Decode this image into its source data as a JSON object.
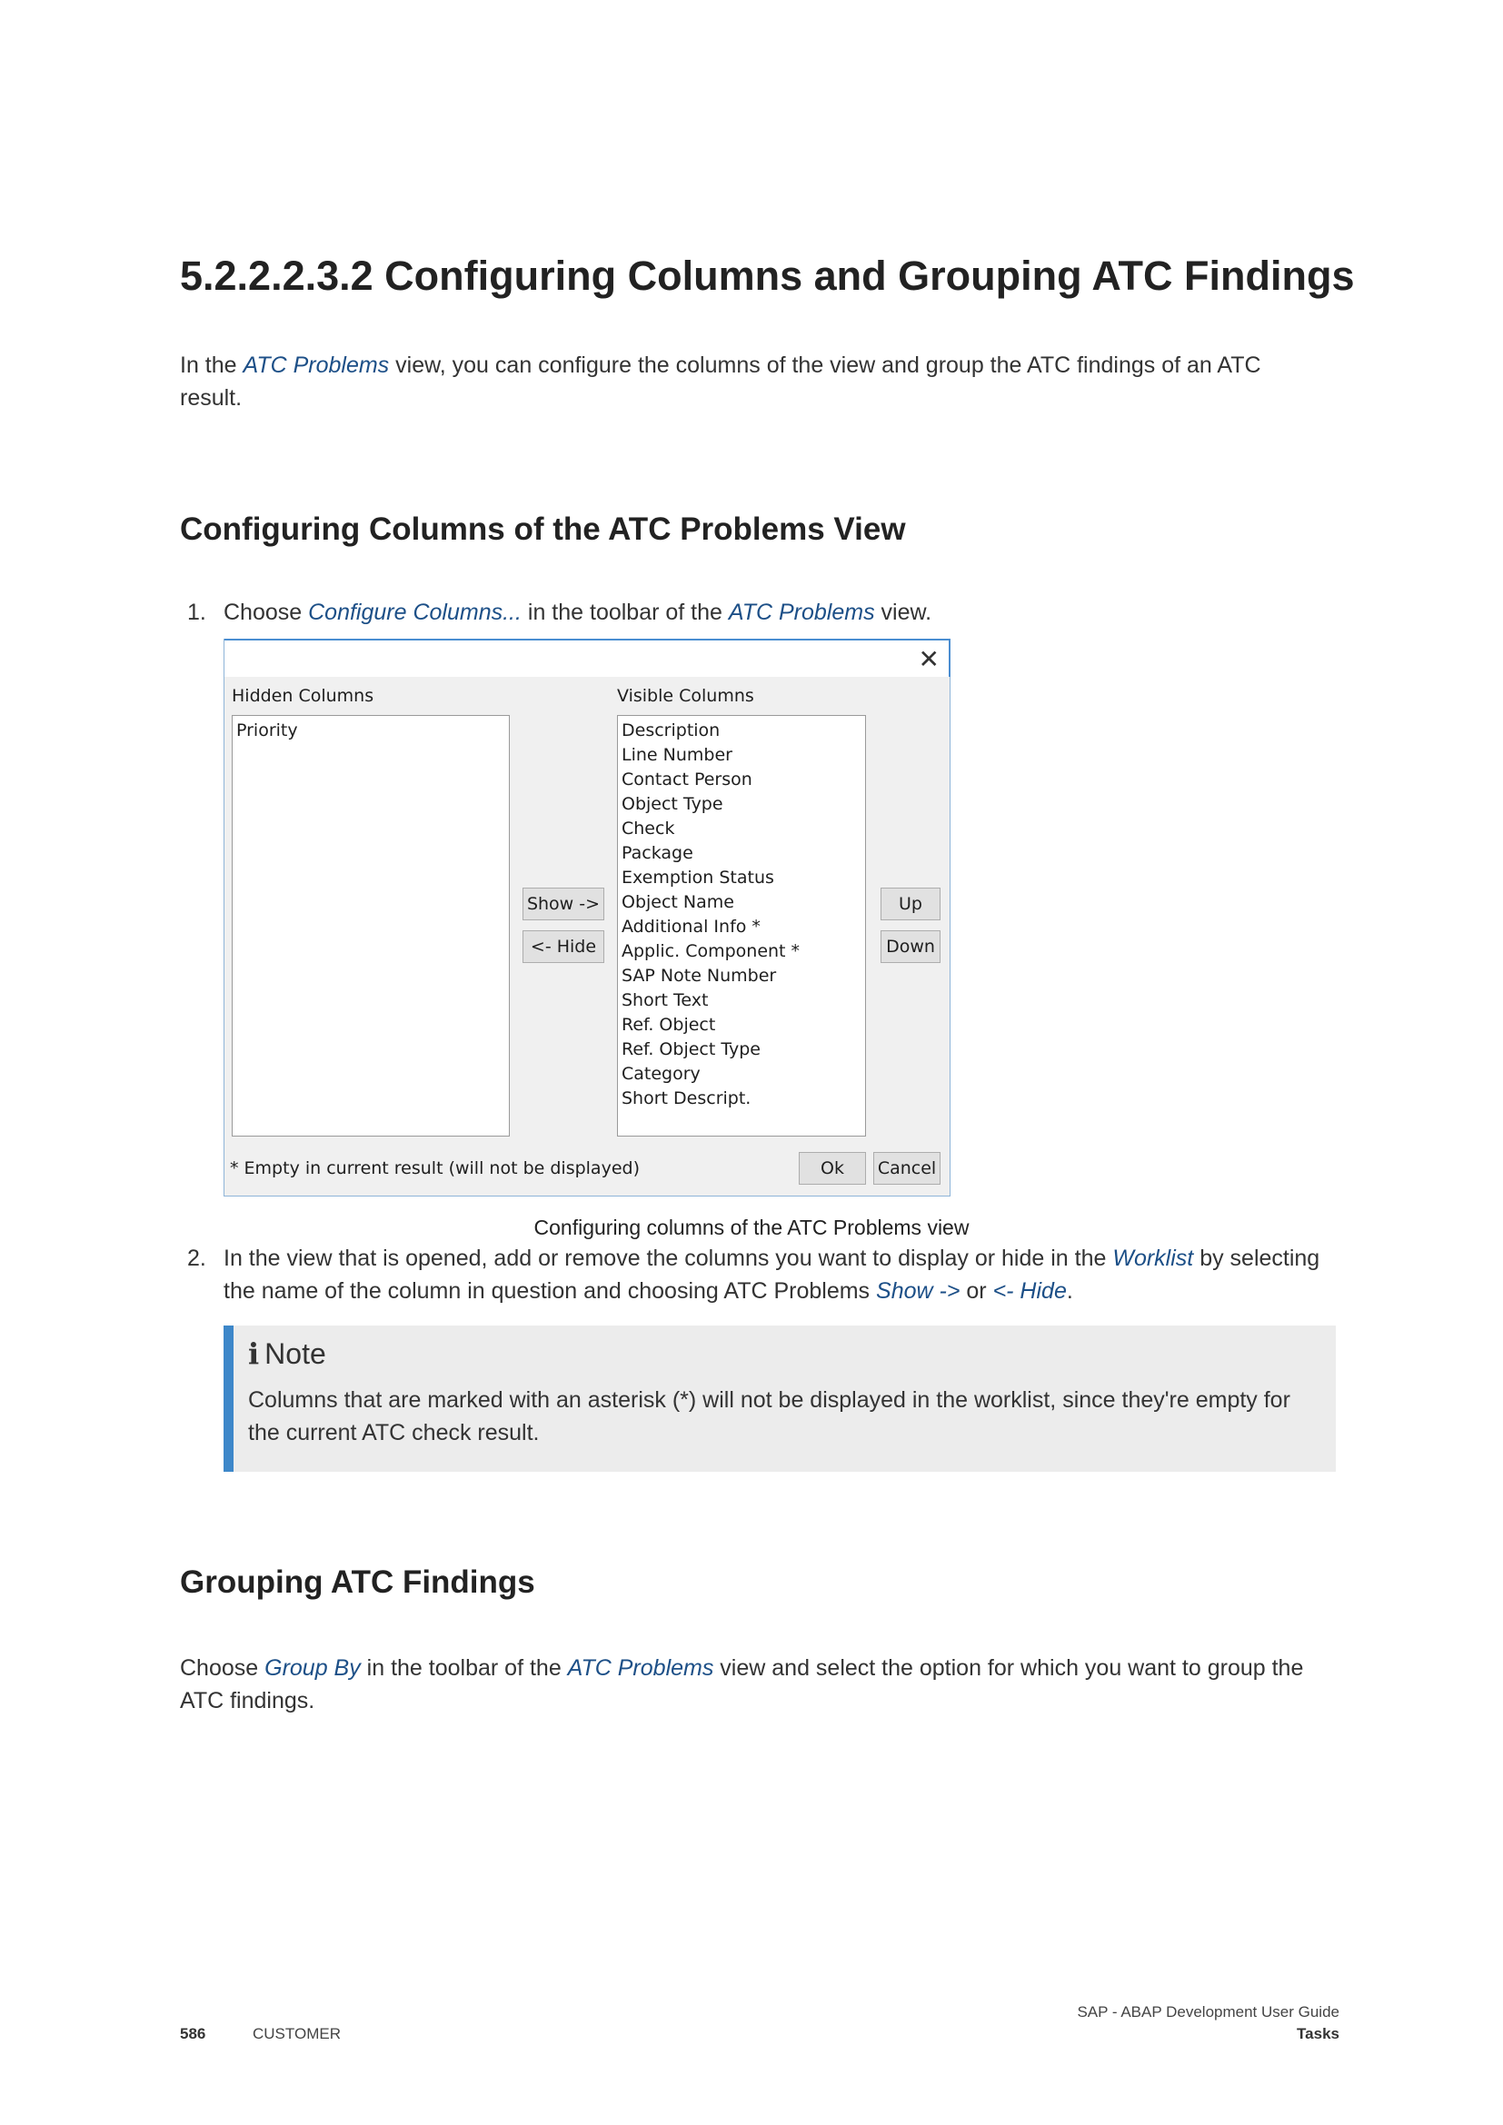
{
  "section_title": "5.2.2.2.3.2  Configuring Columns and Grouping ATC Findings",
  "intro": {
    "pre": "In the ",
    "link": "ATC Problems",
    "post": " view, you can configure the columns of the view and group the ATC findings of an ATC result."
  },
  "subsection1_title": "Configuring Columns of the ATC Problems View",
  "step1": {
    "num": "1.",
    "pre": "Choose ",
    "link1": "Configure Columns...",
    "mid": " in the toolbar of the ",
    "link2": "ATC Problems",
    "post": " view."
  },
  "dialog": {
    "close_glyph": "✕",
    "hidden_label": "Hidden Columns",
    "visible_label": "Visible Columns",
    "hidden_items": [
      "Priority"
    ],
    "visible_items": [
      "Description",
      "Line Number",
      "Contact Person",
      "Object Type",
      "Check",
      "Package",
      "Exemption Status",
      "Object Name",
      "Additional Info *",
      "Applic. Component *",
      "SAP Note Number",
      "Short Text",
      "Ref. Object",
      "Ref. Object Type",
      "Category",
      "Short Descript."
    ],
    "show_button": "Show ->",
    "hide_button": "<- Hide",
    "up_button": "Up",
    "down_button": "Down",
    "footnote": "* Empty in current result (will not be displayed)",
    "ok_button": "Ok",
    "cancel_button": "Cancel"
  },
  "figure_caption": "Configuring columns of the ATC Problems view",
  "step2": {
    "num": "2.",
    "pre": "In the view that is opened, add or remove the columns you want to display or hide in the ",
    "link1": "Worklist",
    "mid": " by selecting the name of the column in question and choosing ATC Problems ",
    "link2": "Show ->",
    "or": " or ",
    "link3": "<- Hide",
    "post": "."
  },
  "note": {
    "icon_glyph": "i",
    "title": "Note",
    "body": "Columns that are marked with an asterisk (*) will not be displayed in the worklist, since they're empty for the current ATC check result."
  },
  "subsection2_title": "Grouping ATC Findings",
  "grouping": {
    "pre": "Choose ",
    "link1": "Group By",
    "mid": " in the toolbar of the ",
    "link2": "ATC Problems",
    "post": " view and select the option for which you want to group the ATC findings."
  },
  "footer": {
    "page_number": "586",
    "classification": "CUSTOMER",
    "doc_title": "SAP - ABAP Development User Guide",
    "chapter": "Tasks"
  }
}
